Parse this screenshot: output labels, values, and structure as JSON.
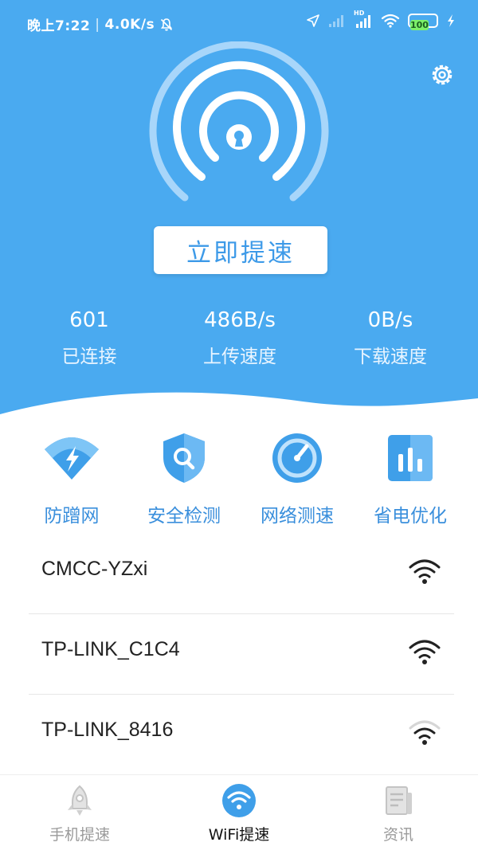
{
  "status_bar": {
    "time": "晚上7:22",
    "net_speed": "4.0K/s",
    "hd_label": "HD",
    "battery": "100"
  },
  "hero": {
    "boost_button_label": "立即提速"
  },
  "stats": [
    {
      "value": "601",
      "label": "已连接"
    },
    {
      "value": "486B/s",
      "label": "上传速度"
    },
    {
      "value": "0B/s",
      "label": "下载速度"
    }
  ],
  "features": [
    {
      "label": "防蹭网",
      "icon": "anti-leech-wifi-icon"
    },
    {
      "label": "安全检测",
      "icon": "security-shield-icon"
    },
    {
      "label": "网络测速",
      "icon": "speed-gauge-icon"
    },
    {
      "label": "省电优化",
      "icon": "power-saving-chart-icon"
    }
  ],
  "wifi_networks": [
    {
      "ssid": "CMCC-YZxi",
      "signal_bars": 3
    },
    {
      "ssid": "TP-LINK_C1C4",
      "signal_bars": 3
    },
    {
      "ssid": "TP-LINK_8416",
      "signal_bars": 2
    }
  ],
  "tabbar": {
    "active": 1,
    "tabs": [
      {
        "label": "手机提速",
        "icon": "rocket-icon"
      },
      {
        "label": "WiFi提速",
        "icon": "wifi-icon"
      },
      {
        "label": "资讯",
        "icon": "news-icon"
      }
    ]
  },
  "colors": {
    "primary": "#4aaaf0",
    "accent_text": "#3a8fdc",
    "battery_fill": "#7cf06a"
  }
}
